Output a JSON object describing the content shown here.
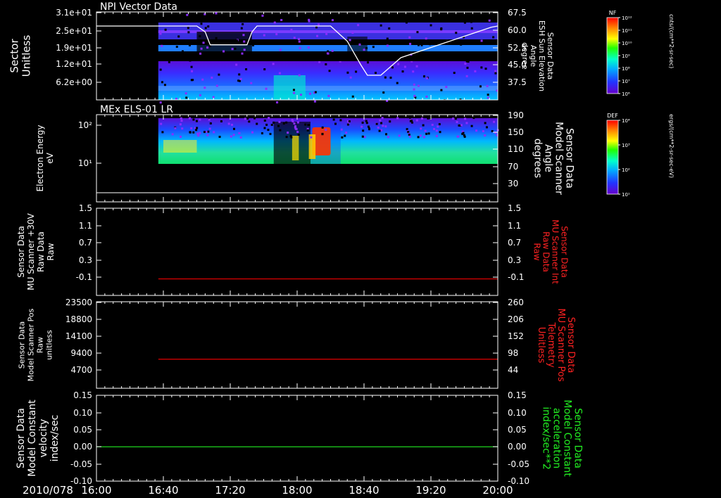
{
  "footer": {
    "date_label": "2010/078"
  },
  "time_axis": {
    "ticks": [
      "16:00",
      "16:40",
      "17:20",
      "18:00",
      "18:40",
      "19:20",
      "20:00"
    ],
    "range_minutes": [
      0,
      240
    ]
  },
  "colorbars": [
    {
      "label": "NF",
      "units": "cnts/(cm**2-sr-sec)",
      "ticks": [
        "10¹²",
        "10¹¹",
        "10¹⁰",
        "10⁹",
        "10⁸",
        "10⁷",
        "10⁶"
      ]
    },
    {
      "label": "DEF",
      "units": "ergs/(cm**2-sr-sec-eV)",
      "ticks": [
        "10⁴",
        "10³",
        "10²",
        "10¹"
      ]
    }
  ],
  "chart_data": [
    {
      "type": "heatmap",
      "title": "NPI Vector Data",
      "ylabel": "Sector Unitless",
      "yticks": [
        "3.1e+01",
        "2.5e+01",
        "1.9e+01",
        "1.2e+01",
        "6.2e+00"
      ],
      "right_ylabel": "Sensor Data ESH Sun Elevation Angle degree",
      "right_yticks": [
        "67.5",
        "60.0",
        "52.5",
        "45.0",
        "37.5"
      ],
      "right_ylim": [
        30,
        67.5
      ],
      "data_start_minutes": 37,
      "overlay_line": {
        "color": "#ffffff",
        "x_minutes": [
          37,
          60,
          65,
          68,
          90,
          93,
          96,
          140,
          150,
          158,
          162,
          170,
          182,
          236,
          240
        ],
        "y_degrees": [
          61.5,
          61.5,
          59.0,
          53.5,
          53.5,
          59.0,
          61.5,
          61.5,
          55.0,
          45.0,
          40.5,
          40.5,
          48.0,
          61.0,
          61.5
        ]
      }
    },
    {
      "type": "heatmap",
      "title": "MEx ELS-01 LR",
      "ylabel": "Electron Energy eV",
      "yticks": [
        "10²",
        "10¹"
      ],
      "right_ylabel": "Sensor Data Model Scanner Angle degrees",
      "right_yticks": [
        "190",
        "150",
        "110",
        "70",
        "30"
      ],
      "data_start_minutes": 37,
      "overlay_line": {
        "color": "#ffffff",
        "y_degrees": 19
      }
    },
    {
      "type": "line",
      "ylabel": "Sensor Data MU Scanner +30V Raw Data Raw",
      "yticks": [
        "1.5",
        "1.1",
        "0.7",
        "0.3",
        "-0.1"
      ],
      "ylim": [
        -0.35,
        1.5
      ],
      "right_ylabel": "Sensor Data MU Scanner Int Raw Data Raw",
      "right_yticks": [
        "1.5",
        "1.1",
        "0.7",
        "0.3",
        "-0.1"
      ],
      "series": [
        {
          "color": "#dd0000",
          "x_minutes": [
            37,
            240
          ],
          "values": [
            0.0,
            0.0
          ]
        }
      ]
    },
    {
      "type": "line",
      "ylabel": "Sensor Data Model Scanner Pos Raw unitless",
      "yticks": [
        "23500",
        "18800",
        "14100",
        "9400",
        "4700"
      ],
      "ylim": [
        900,
        23500
      ],
      "right_ylabel": "Sensor Data MU Scanner Pos Telemetry Unitless",
      "right_yticks": [
        "260",
        "206",
        "152",
        "98",
        "44"
      ],
      "series": [
        {
          "color": "#dd0000",
          "x_minutes": [
            37,
            240
          ],
          "values": [
            8500,
            8500
          ]
        }
      ]
    },
    {
      "type": "line",
      "ylabel": "Sensor Data Model Constant velocity index/sec",
      "yticks": [
        "0.15",
        "0.10",
        "0.05",
        "0.00",
        "-0.05",
        "-0.10"
      ],
      "ylim": [
        -0.1,
        0.15
      ],
      "right_ylabel": "Sensor Data Model Constant acceleration index/sec**2",
      "right_yticks": [
        "0.15",
        "0.10",
        "0.05",
        "0.00",
        "-0.05",
        "-0.10"
      ],
      "series": [
        {
          "color": "#22ee22",
          "x_minutes": [
            0,
            240
          ],
          "values": [
            0.0,
            0.0
          ]
        }
      ]
    }
  ],
  "colors": {
    "axis": "#ffffff",
    "red_label": "#ff2222",
    "green_label": "#22ee22"
  }
}
